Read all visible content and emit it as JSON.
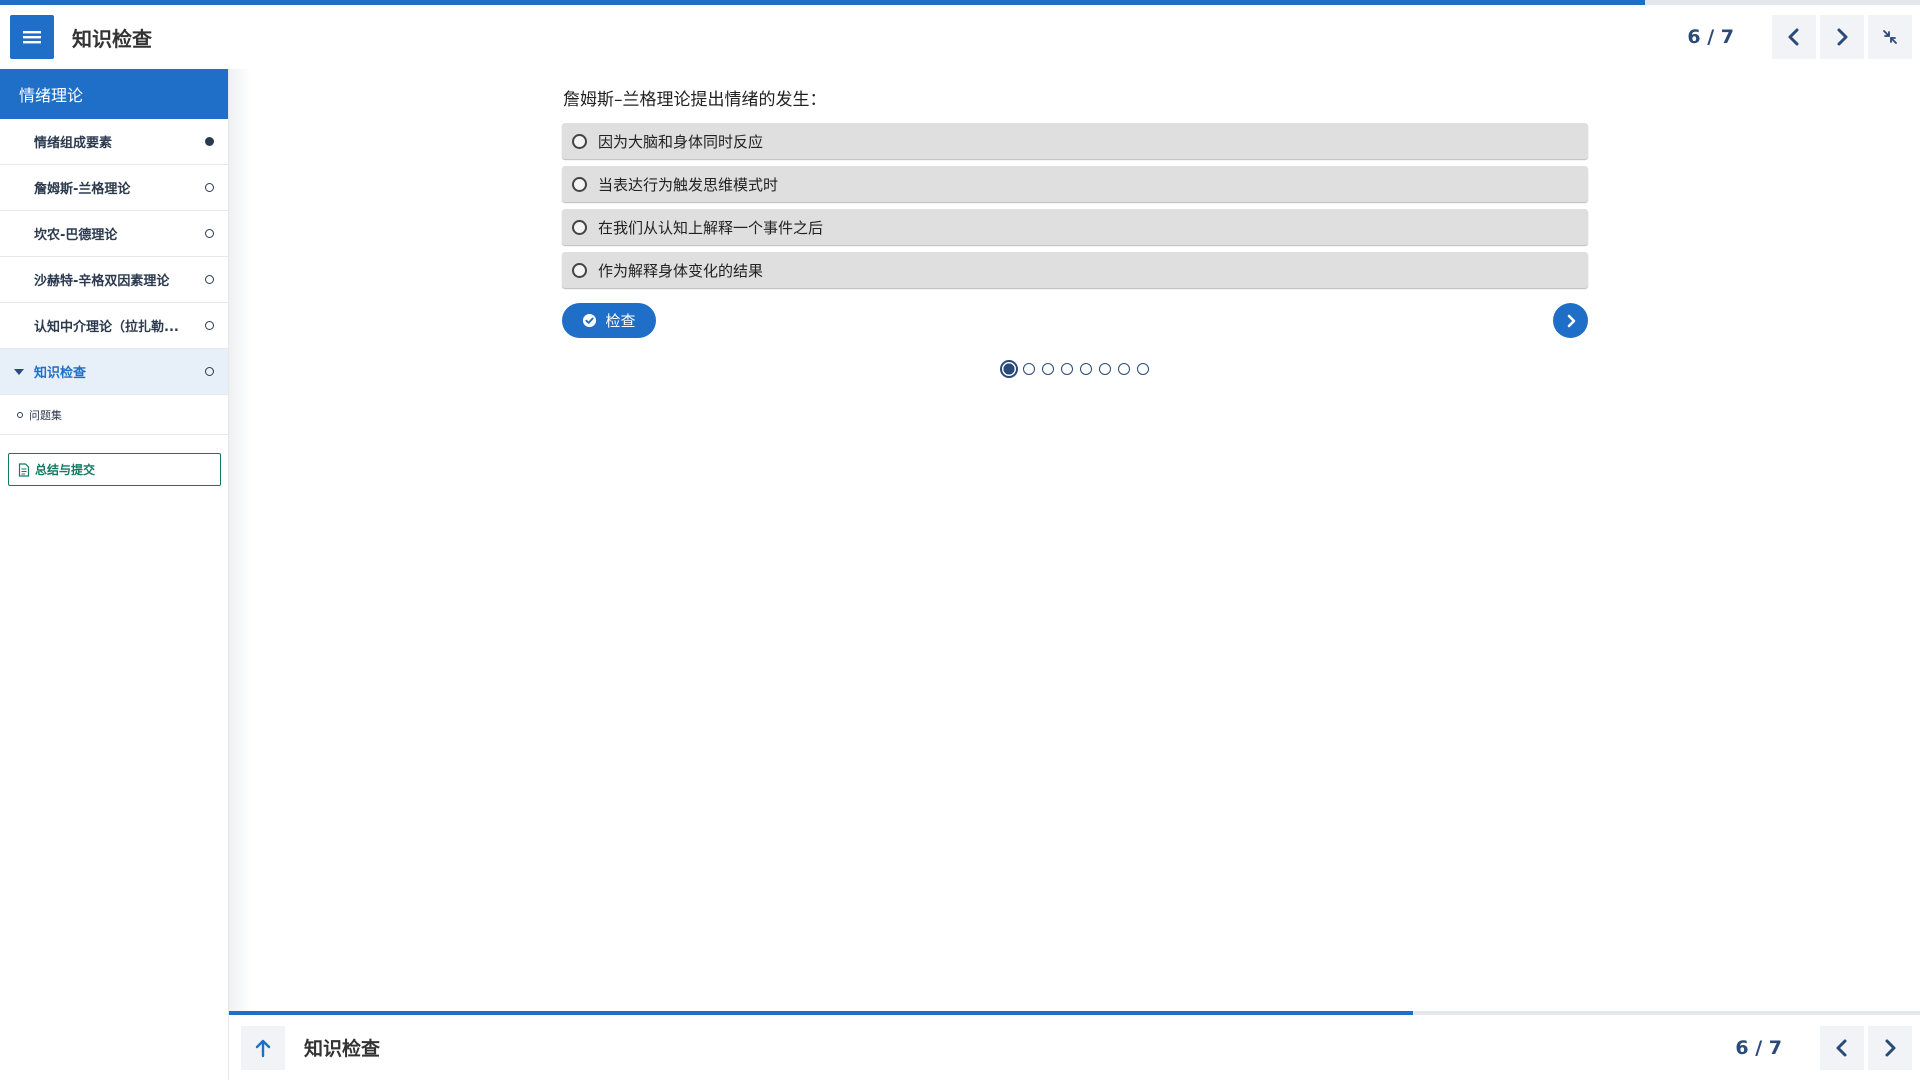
{
  "progress": {
    "top_fraction": 0.857,
    "footer_fraction": 0.7
  },
  "header": {
    "title": "知识检查",
    "page_count": "6 / 7",
    "icons": {
      "menu": "hamburger-menu-icon",
      "prev": "chevron-left-icon",
      "next": "chevron-right-icon",
      "collapse": "minimize-icon"
    }
  },
  "sidebar": {
    "section_title": "情绪理论",
    "items": [
      {
        "label": "情绪组成要素",
        "status": "filled"
      },
      {
        "label": "詹姆斯-兰格理论",
        "status": "empty"
      },
      {
        "label": "坎农-巴德理论",
        "status": "empty"
      },
      {
        "label": "沙赫特-辛格双因素理论",
        "status": "empty"
      },
      {
        "label": "认知中介理论（拉扎勒...",
        "status": "empty"
      },
      {
        "label": "知识检查",
        "status": "empty",
        "active": true
      }
    ],
    "sub_items": [
      {
        "label": "问题集"
      }
    ],
    "summary_button": "总结与提交"
  },
  "quiz": {
    "question": "詹姆斯–兰格理论提出情绪的发生：",
    "options": [
      "因为大脑和身体同时反应",
      "当表达行为触发思维模式时",
      "在我们从认知上解释一个事件之后",
      "作为解释身体变化的结果"
    ],
    "check_button": "检查",
    "pager": {
      "total": 8,
      "current": 1
    }
  },
  "footer": {
    "title": "知识检查",
    "page_count": "6 / 7"
  },
  "colors": {
    "accent": "#1f6fc8",
    "navy": "#2a4a78",
    "teal": "#157a63"
  }
}
